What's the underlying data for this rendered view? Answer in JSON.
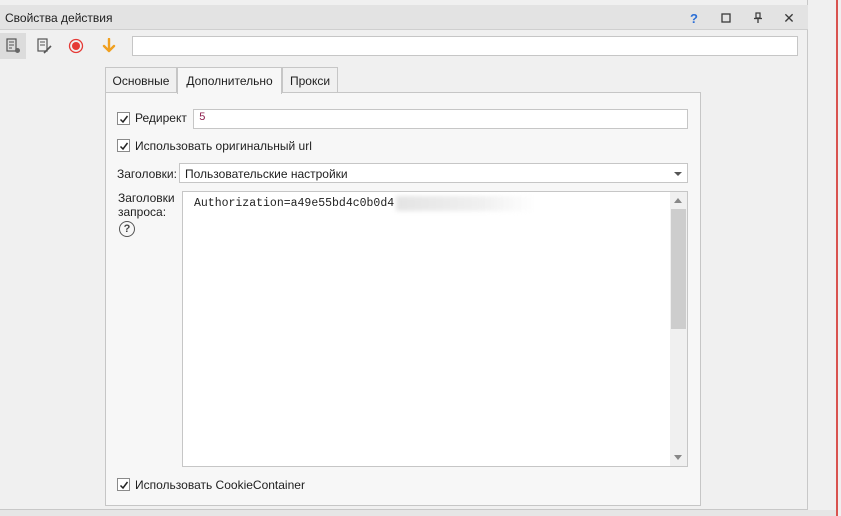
{
  "window": {
    "title": "Свойства действия",
    "help": "?",
    "maximize": "☐",
    "pin": "⬍",
    "close": "✕"
  },
  "toolbar": {
    "icons": [
      "properties-icon",
      "edit-icon",
      "record-icon",
      "down-arrow-icon"
    ],
    "input_value": ""
  },
  "tabs": [
    {
      "label": "Основные",
      "active": false
    },
    {
      "label": "Дополнительно",
      "active": true
    },
    {
      "label": "Прокси",
      "active": false
    }
  ],
  "form": {
    "redirect": {
      "label": "Редирект",
      "checked": true,
      "value": "5"
    },
    "use_original_url": {
      "label": "Использовать оригинальный url",
      "checked": true
    },
    "headers": {
      "label": "Заголовки:",
      "selected": "Пользовательские настройки"
    },
    "request_headers": {
      "label_line1": "Заголовки",
      "label_line2": "запроса:",
      "help": "?",
      "text": "Authorization=a49e55bd4c0b0d4"
    },
    "use_cookie_container": {
      "label": "Использовать CookieContainer",
      "checked": true
    }
  },
  "colors": {
    "record": "#e53935",
    "arrow": "#f0a020",
    "help": "#2c6fd6",
    "accent_edge": "#d9534f"
  }
}
